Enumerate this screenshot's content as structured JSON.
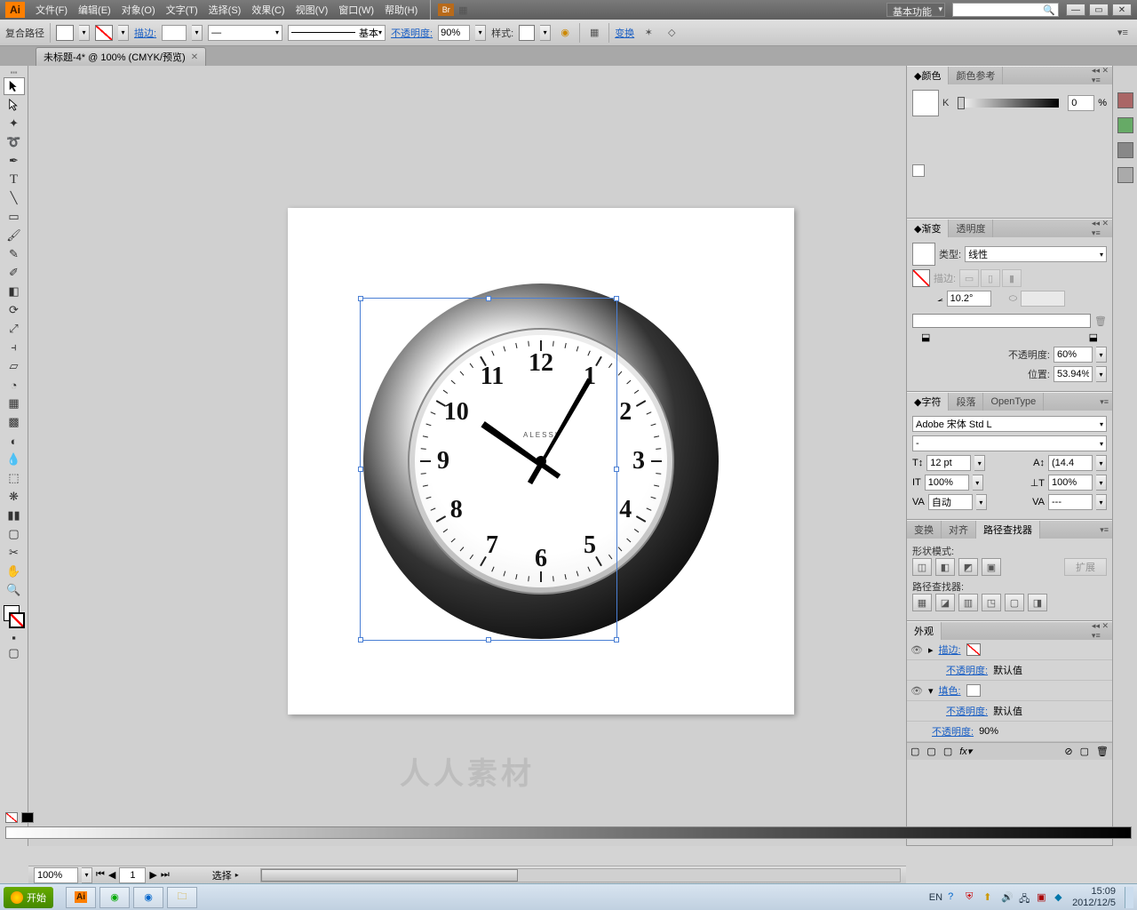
{
  "app": {
    "logo": "Ai",
    "workspace": "基本功能"
  },
  "menu": [
    "文件(F)",
    "编辑(E)",
    "对象(O)",
    "文字(T)",
    "选择(S)",
    "效果(C)",
    "视图(V)",
    "窗口(W)",
    "帮助(H)"
  ],
  "controlbar": {
    "selection_type": "复合路径",
    "stroke_label": "描边:",
    "stroke_weight": "",
    "brush_label": "基本",
    "opacity_label": "不透明度:",
    "opacity_value": "90%",
    "style_label": "样式:",
    "transform_link": "变换"
  },
  "doc_tab": {
    "title": "未标题-4* @ 100% (CMYK/预览)"
  },
  "artwork": {
    "brand": "ALESSI",
    "numerals": [
      "12",
      "1",
      "2",
      "3",
      "4",
      "5",
      "6",
      "7",
      "8",
      "9",
      "10",
      "11"
    ]
  },
  "panels": {
    "color": {
      "tab1": "颜色",
      "tab2": "颜色参考",
      "channel": "K",
      "value": "0",
      "pct": "%"
    },
    "gradient": {
      "tab1": "渐变",
      "tab2": "透明度",
      "type_label": "类型:",
      "type_value": "线性",
      "stroke_label": "描边:",
      "angle_value": "10.2°",
      "opacity_label": "不透明度:",
      "opacity_value": "60%",
      "position_label": "位置:",
      "position_value": "53.94%"
    },
    "character": {
      "tab1": "字符",
      "tab2": "段落",
      "tab3": "OpenType",
      "font": "Adobe 宋体 Std L",
      "style": "-",
      "size": "12 pt",
      "leading": "(14.4",
      "hscale": "100%",
      "vscale": "100%",
      "kerning": "自动",
      "tracking": "---"
    },
    "pathfinder": {
      "tab1": "变换",
      "tab2": "对齐",
      "tab3": "路径查找器",
      "shape_modes": "形状模式:",
      "expand": "扩展",
      "pathfinders": "路径查找器:"
    },
    "appearance": {
      "tab": "外观",
      "row1": "描边:",
      "row2_label": "不透明度:",
      "row2_val": "默认值",
      "row3": "填色:",
      "row4_label": "不透明度:",
      "row4_val": "默认值",
      "row5_label": "不透明度:",
      "row5_val": "90%"
    }
  },
  "statusbar": {
    "zoom": "100%",
    "page": "1",
    "label": "选择"
  },
  "taskbar": {
    "start": "开始",
    "lang": "EN",
    "time": "15:09",
    "date": "2012/12/5"
  },
  "watermark": "人人素材"
}
